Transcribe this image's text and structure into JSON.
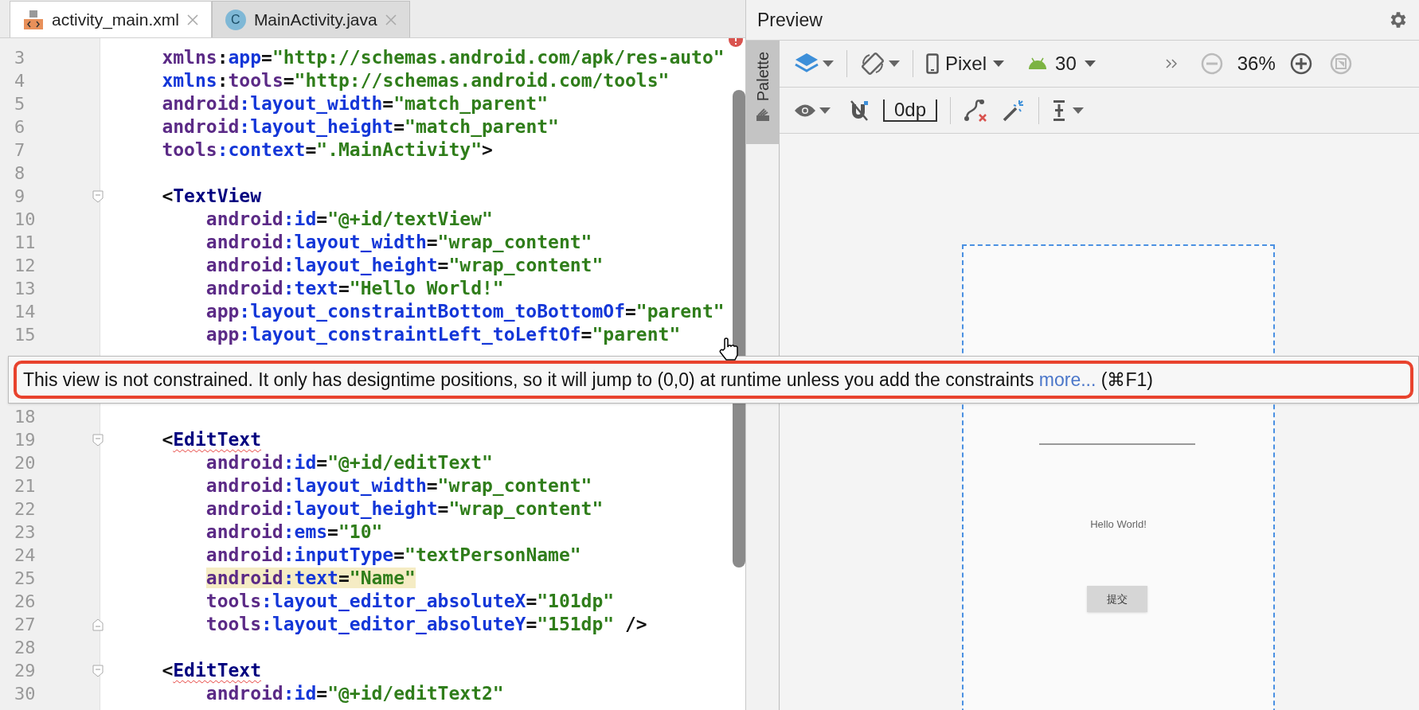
{
  "tabs": [
    {
      "label": "activity_main.xml",
      "kind": "xml",
      "selected": true
    },
    {
      "label": "MainActivity.java",
      "kind": "java",
      "icon_letter": "C",
      "selected": false
    }
  ],
  "editor": {
    "upper_lines": [
      {
        "number": "3",
        "tokens": [
          {
            "kind": "ns",
            "text": "    xmlns"
          },
          {
            "kind": "punct",
            "text": ":"
          },
          {
            "kind": "attr",
            "text": "app"
          },
          {
            "kind": "punct",
            "text": "="
          },
          {
            "kind": "val",
            "text": "\"http://schemas.android.com/apk/res-auto\""
          }
        ]
      },
      {
        "number": "4",
        "tokens": [
          {
            "kind": "attr",
            "text": "    xmlns"
          },
          {
            "kind": "punct",
            "text": ":"
          },
          {
            "kind": "ns",
            "text": "tools"
          },
          {
            "kind": "punct",
            "text": "="
          },
          {
            "kind": "val",
            "text": "\"http://schemas.android.com/tools\""
          }
        ]
      },
      {
        "number": "5",
        "tokens": [
          {
            "kind": "ns",
            "text": "    android"
          },
          {
            "kind": "attr",
            "text": ":layout_width"
          },
          {
            "kind": "punct",
            "text": "="
          },
          {
            "kind": "val",
            "text": "\"match_parent\""
          }
        ]
      },
      {
        "number": "6",
        "tokens": [
          {
            "kind": "ns",
            "text": "    android"
          },
          {
            "kind": "attr",
            "text": ":layout_height"
          },
          {
            "kind": "punct",
            "text": "="
          },
          {
            "kind": "val",
            "text": "\"match_parent\""
          }
        ]
      },
      {
        "number": "7",
        "tokens": [
          {
            "kind": "ns",
            "text": "    tools"
          },
          {
            "kind": "attr",
            "text": ":context"
          },
          {
            "kind": "punct",
            "text": "="
          },
          {
            "kind": "val",
            "text": "\".MainActivity\""
          },
          {
            "kind": "punct",
            "text": ">"
          }
        ]
      },
      {
        "number": "8"
      },
      {
        "number": "9",
        "fold_start": true,
        "tokens": [
          {
            "kind": "punct",
            "text": "    <"
          },
          {
            "kind": "tag",
            "text": "TextView"
          }
        ]
      },
      {
        "number": "10",
        "tokens": [
          {
            "kind": "ns",
            "text": "        android"
          },
          {
            "kind": "attr",
            "text": ":id"
          },
          {
            "kind": "punct",
            "text": "="
          },
          {
            "kind": "val",
            "text": "\"@+id/textView\""
          }
        ]
      },
      {
        "number": "11",
        "tokens": [
          {
            "kind": "ns",
            "text": "        android"
          },
          {
            "kind": "attr",
            "text": ":layout_width"
          },
          {
            "kind": "punct",
            "text": "="
          },
          {
            "kind": "val",
            "text": "\"wrap_content\""
          }
        ]
      },
      {
        "number": "12",
        "tokens": [
          {
            "kind": "ns",
            "text": "        android"
          },
          {
            "kind": "attr",
            "text": ":layout_height"
          },
          {
            "kind": "punct",
            "text": "="
          },
          {
            "kind": "val",
            "text": "\"wrap_content\""
          }
        ]
      },
      {
        "number": "13",
        "tokens": [
          {
            "kind": "ns",
            "text": "        android"
          },
          {
            "kind": "attr",
            "text": ":text"
          },
          {
            "kind": "punct",
            "text": "="
          },
          {
            "kind": "val",
            "text": "\"Hello World!\""
          }
        ]
      },
      {
        "number": "14",
        "tokens": [
          {
            "kind": "ns",
            "text": "        app"
          },
          {
            "kind": "attr",
            "text": ":layout_constraintBottom_toBottomOf"
          },
          {
            "kind": "punct",
            "text": "="
          },
          {
            "kind": "val",
            "text": "\"parent\""
          }
        ]
      },
      {
        "number": "15",
        "tokens": [
          {
            "kind": "ns",
            "text": "        app"
          },
          {
            "kind": "attr",
            "text": ":layout_constraintLeft_toLeftOf"
          },
          {
            "kind": "punct",
            "text": "="
          },
          {
            "kind": "val",
            "text": "\"parent\""
          }
        ]
      }
    ],
    "lower_lines": [
      {
        "number": "18"
      },
      {
        "number": "19",
        "fold_start": true,
        "tokens": [
          {
            "kind": "punct",
            "text": "    <"
          },
          {
            "kind": "tag_error",
            "text": "EditText"
          }
        ]
      },
      {
        "number": "20",
        "tokens": [
          {
            "kind": "ns",
            "text": "        android"
          },
          {
            "kind": "attr",
            "text": ":id"
          },
          {
            "kind": "punct",
            "text": "="
          },
          {
            "kind": "val",
            "text": "\"@+id/editText\""
          }
        ]
      },
      {
        "number": "21",
        "tokens": [
          {
            "kind": "ns",
            "text": "        android"
          },
          {
            "kind": "attr",
            "text": ":layout_width"
          },
          {
            "kind": "punct",
            "text": "="
          },
          {
            "kind": "val",
            "text": "\"wrap_content\""
          }
        ]
      },
      {
        "number": "22",
        "tokens": [
          {
            "kind": "ns",
            "text": "        android"
          },
          {
            "kind": "attr",
            "text": ":layout_height"
          },
          {
            "kind": "punct",
            "text": "="
          },
          {
            "kind": "val",
            "text": "\"wrap_content\""
          }
        ]
      },
      {
        "number": "23",
        "tokens": [
          {
            "kind": "ns",
            "text": "        android"
          },
          {
            "kind": "attr",
            "text": ":ems"
          },
          {
            "kind": "punct",
            "text": "="
          },
          {
            "kind": "val",
            "text": "\"10\""
          }
        ]
      },
      {
        "number": "24",
        "tokens": [
          {
            "kind": "ns",
            "text": "        android"
          },
          {
            "kind": "attr",
            "text": ":inputType"
          },
          {
            "kind": "punct",
            "text": "="
          },
          {
            "kind": "val",
            "text": "\"textPersonName\""
          }
        ]
      },
      {
        "number": "25",
        "highlighted": true,
        "tokens": [
          {
            "kind": "ns",
            "text": "        android"
          },
          {
            "kind": "attr",
            "text": ":text"
          },
          {
            "kind": "punct",
            "text": "="
          },
          {
            "kind": "val",
            "text": "\"Name\""
          }
        ]
      },
      {
        "number": "26",
        "tokens": [
          {
            "kind": "ns",
            "text": "        tools"
          },
          {
            "kind": "attr",
            "text": ":layout_editor_absoluteX"
          },
          {
            "kind": "punct",
            "text": "="
          },
          {
            "kind": "val",
            "text": "\"101dp\""
          }
        ]
      },
      {
        "number": "27",
        "fold_end": true,
        "tokens": [
          {
            "kind": "ns",
            "text": "        tools"
          },
          {
            "kind": "attr",
            "text": ":layout_editor_absoluteY"
          },
          {
            "kind": "punct",
            "text": "="
          },
          {
            "kind": "val",
            "text": "\"151dp\""
          },
          {
            "kind": "punct",
            "text": " />"
          }
        ]
      },
      {
        "number": "28"
      },
      {
        "number": "29",
        "fold_start": true,
        "tokens": [
          {
            "kind": "punct",
            "text": "    <"
          },
          {
            "kind": "tag_error",
            "text": "EditText"
          }
        ]
      },
      {
        "number": "30",
        "tokens": [
          {
            "kind": "ns",
            "text": "        android"
          },
          {
            "kind": "attr",
            "text": ":id"
          },
          {
            "kind": "punct",
            "text": "="
          },
          {
            "kind": "val",
            "text": "\"@+id/editText2\""
          }
        ]
      }
    ]
  },
  "tooltip": {
    "text": "This view is not constrained. It only has designtime positions, so it will jump to (0,0) at runtime unless you add the constraints ",
    "link": "more...",
    "shortcut": " (⌘F1)"
  },
  "preview": {
    "title": "Preview",
    "palette_label": "Palette",
    "device": "Pixel",
    "api": "30",
    "zoom": "36%",
    "margin": "0dp",
    "phone": {
      "hello_text": "Hello World!",
      "button_label": "提交"
    }
  }
}
